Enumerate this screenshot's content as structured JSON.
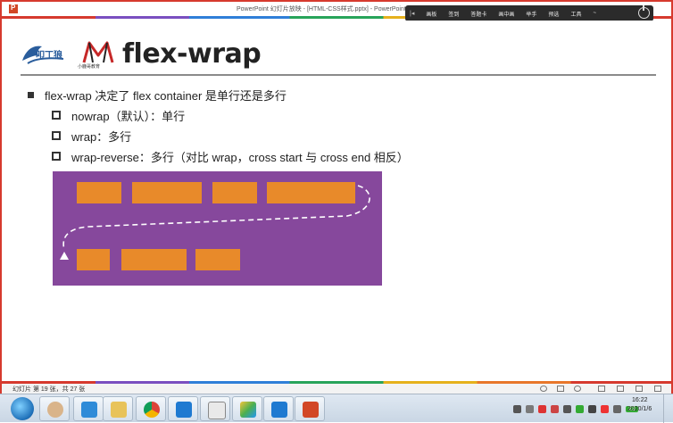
{
  "window": {
    "title": "PowerPoint 幻灯片放映 - [HTML-CSS样式.pptx] - PowerPoint"
  },
  "presenter_toolbar": {
    "items": [
      "画板",
      "签到",
      "答题卡",
      "画中画",
      "举手",
      "预选",
      "工具"
    ],
    "more": "~"
  },
  "slide": {
    "logo_text": "小鹿哥教育",
    "title": "flex-wrap",
    "bullet_main": "flex-wrap 决定了 flex container 是单行还是多行",
    "sub_bullets": [
      "nowrap（默认）：单行",
      "wrap：多行",
      "wrap-reverse：多行（对比 wrap，cross start 与 cross end 相反）"
    ]
  },
  "status": {
    "slide_counter": "幻灯片 第 19 张，共 27 张"
  },
  "taskbar": {
    "clock_time": "16:22",
    "clock_date": "2020/1/6",
    "tray_badge": "23"
  },
  "colors": {
    "accent_red": "#d63a2e",
    "diagram_bg": "#86489c",
    "flex_item": "#e88a2a"
  }
}
